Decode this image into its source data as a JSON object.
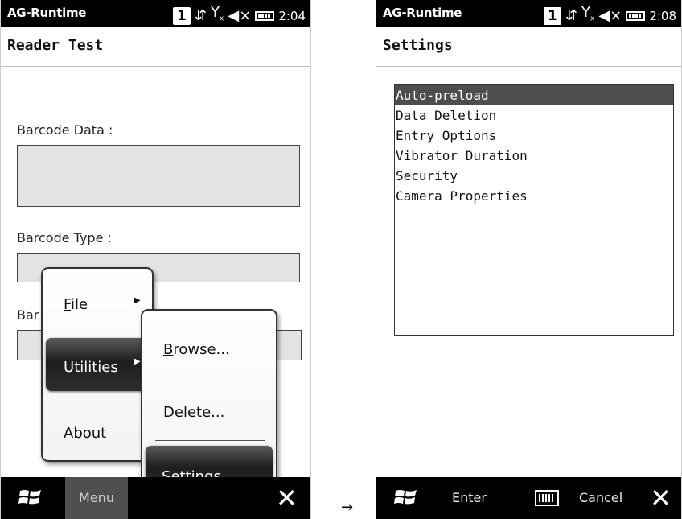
{
  "left_screen": {
    "statusbar": {
      "app": "AG-Runtime",
      "badge": "1",
      "time": "2:04"
    },
    "title": "Reader Test",
    "barcode_data_label": "Barcode Data :",
    "barcode_type_label": "Barcode Type :",
    "partial_label": "Bar",
    "main_menu": {
      "file": {
        "mnemonic": "F",
        "rest": "ile"
      },
      "utilities": {
        "mnemonic": "U",
        "rest": "tilities"
      },
      "about": {
        "mnemonic": "A",
        "rest": "bout"
      }
    },
    "sub_menu": {
      "browse": {
        "mnemonic": "B",
        "rest": "rowse..."
      },
      "delete": {
        "mnemonic": "D",
        "rest": "elete..."
      },
      "settings": {
        "mnemonic": "S",
        "rest": "ettings..."
      }
    },
    "bottombar": {
      "menu": "Menu"
    }
  },
  "transition_arrow": "→",
  "right_screen": {
    "statusbar": {
      "app": "AG-Runtime",
      "badge": "1",
      "time": "2:08"
    },
    "title": "Settings",
    "list": [
      "Auto-preload",
      "Data Deletion",
      "Entry Options",
      "Vibrator Duration",
      "Security",
      "Camera Properties"
    ],
    "selected_index": 0,
    "bottombar": {
      "enter": "Enter",
      "cancel": "Cancel"
    }
  },
  "icons": {
    "signal_arrows": "⇵",
    "no_signal": "Y",
    "speaker_off": "◀",
    "windows": "windows-logo-icon",
    "close": "✕"
  }
}
